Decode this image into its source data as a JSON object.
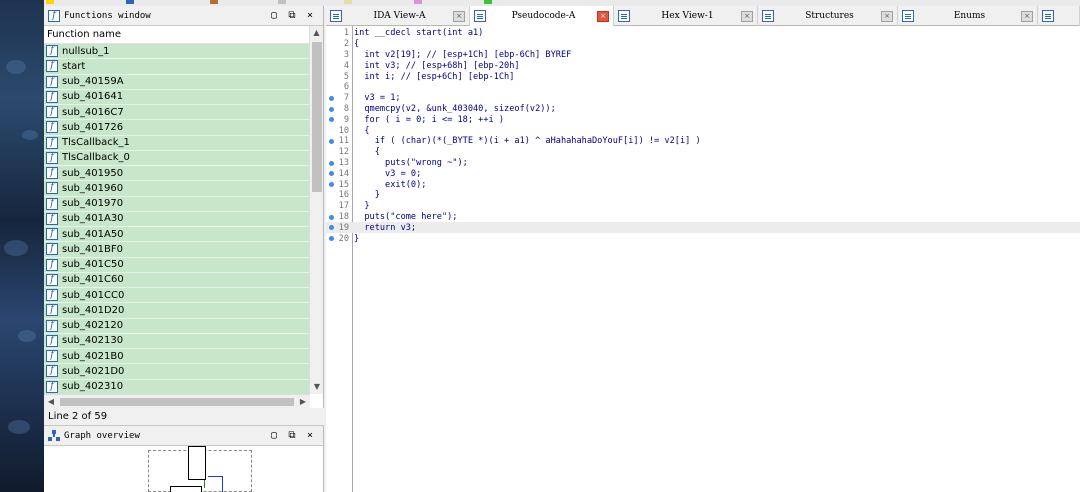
{
  "functions_window": {
    "title": "Functions window",
    "column_header": "Function name",
    "items": [
      "nullsub_1",
      "start",
      "sub_40159A",
      "sub_401641",
      "sub_4016C7",
      "sub_401726",
      "TlsCallback_1",
      "TlsCallback_0",
      "sub_401950",
      "sub_401960",
      "sub_401970",
      "sub_401A30",
      "sub_401A50",
      "sub_401BF0",
      "sub_401C50",
      "sub_401C60",
      "sub_401CC0",
      "sub_401D20",
      "sub_402120",
      "sub_402130",
      "sub_4021B0",
      "sub_4021D0",
      "sub_402310"
    ],
    "status": "Line 2 of 59"
  },
  "graph_overview": {
    "title": "Graph overview"
  },
  "tabs": [
    {
      "label": "IDA View-A",
      "active": false
    },
    {
      "label": "Pseudocode-A",
      "active": true
    },
    {
      "label": "Hex View-1",
      "active": false
    },
    {
      "label": "Structures",
      "active": false
    },
    {
      "label": "Enums",
      "active": false
    }
  ],
  "pseudocode": [
    {
      "n": "1",
      "text": "int __cdecl start(int a1)",
      "dot": false
    },
    {
      "n": "2",
      "text": "{",
      "dot": false
    },
    {
      "n": "3",
      "text": "  int v2[19]; // [esp+1Ch] [ebp-6Ch] BYREF",
      "dot": false
    },
    {
      "n": "4",
      "text": "  int v3; // [esp+68h] [ebp-20h]",
      "dot": false
    },
    {
      "n": "5",
      "text": "  int i; // [esp+6Ch] [ebp-1Ch]",
      "dot": false
    },
    {
      "n": "6",
      "text": "",
      "dot": false
    },
    {
      "n": "7",
      "text": "  v3 = 1;",
      "dot": true
    },
    {
      "n": "8",
      "text": "  qmemcpy(v2, &unk_403040, sizeof(v2));",
      "dot": true
    },
    {
      "n": "9",
      "text": "  for ( i = 0; i <= 18; ++i )",
      "dot": true
    },
    {
      "n": "10",
      "text": "  {",
      "dot": false
    },
    {
      "n": "11",
      "text": "    if ( (char)(*(_BYTE *)(i + a1) ^ aHahahahaDoYouF[i]) != v2[i] )",
      "dot": true
    },
    {
      "n": "12",
      "text": "    {",
      "dot": false
    },
    {
      "n": "13",
      "text": "      puts(\"wrong ~\");",
      "dot": true
    },
    {
      "n": "14",
      "text": "      v3 = 0;",
      "dot": true
    },
    {
      "n": "15",
      "text": "      exit(0);",
      "dot": true
    },
    {
      "n": "16",
      "text": "    }",
      "dot": false
    },
    {
      "n": "17",
      "text": "  }",
      "dot": false
    },
    {
      "n": "18",
      "text": "  puts(\"come here\");",
      "dot": true
    },
    {
      "n": "19",
      "text": "  return v3;",
      "dot": true
    },
    {
      "n": "20",
      "text": "}",
      "dot": true
    }
  ],
  "current_line": "19",
  "colors": {
    "function_row_bg": "#c8e6c9",
    "icon_blue": "#2c66b4",
    "active_close": "#e05a3a",
    "breakpoint_dot": "#3d8de0"
  }
}
